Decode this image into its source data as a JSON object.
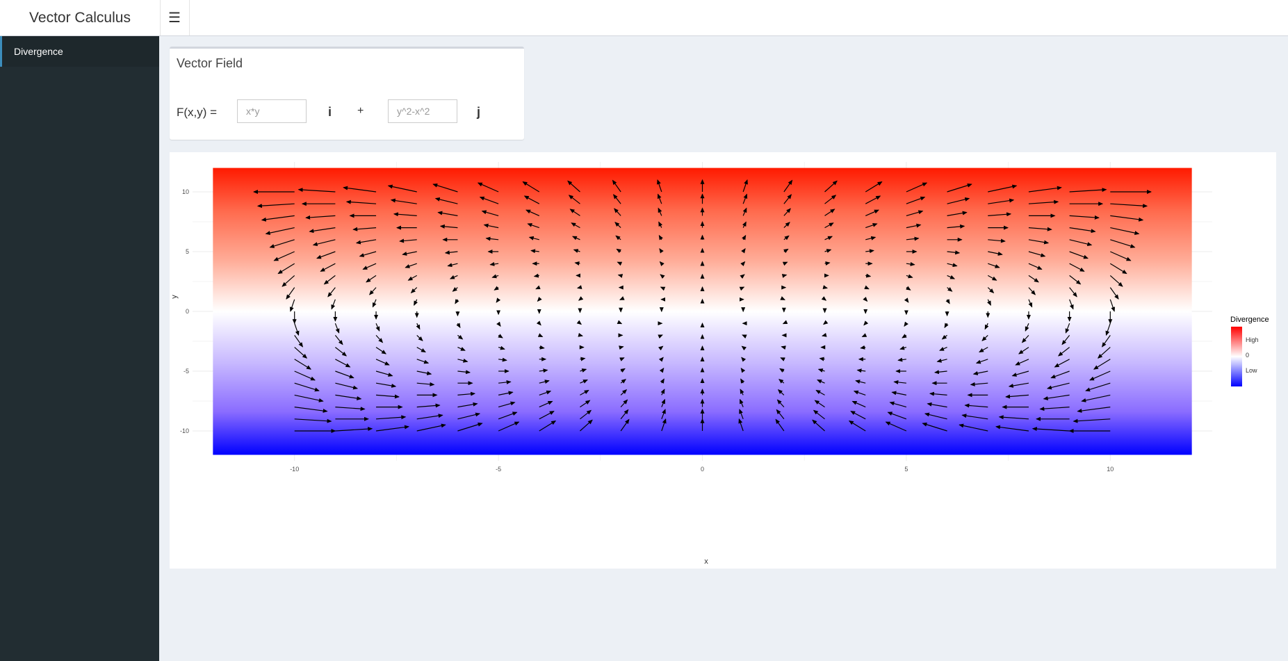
{
  "app": {
    "title": "Vector Calculus"
  },
  "header": {
    "toggle_icon": "hamburger-menu-icon"
  },
  "sidebar": {
    "items": [
      {
        "label": "Divergence",
        "active": true
      }
    ]
  },
  "vector_field": {
    "title": "Vector Field",
    "f_label": "F(x,y) =",
    "i_field": {
      "value": "",
      "placeholder": "x*y"
    },
    "i_unit": "i",
    "plus": "+",
    "j_field": {
      "value": "",
      "placeholder": "y^2-x^2"
    },
    "j_unit": "j"
  },
  "colors": {
    "high": "#ff0000",
    "zero": "#ffffff",
    "low": "#0000ff",
    "arrow": "#000000",
    "accent": "#3c8dbc"
  },
  "chart_data": {
    "type": "vector-field",
    "field": {
      "Fx": "x*y",
      "Fy": "y^2-x^2"
    },
    "grid": {
      "x_from": -10,
      "x_to": 10,
      "x_step": 1,
      "y_from": -10,
      "y_to": 10,
      "y_step": 1
    },
    "xlim": [
      -12.5,
      12.5
    ],
    "ylim": [
      -12.5,
      12.5
    ],
    "divergence_fill": {
      "x_range": [
        -12,
        12
      ],
      "y_range": [
        -12,
        12
      ],
      "divergence": "3*y"
    },
    "x_ticks": [
      -10,
      -5,
      0,
      5,
      10
    ],
    "x_tick_labels": [
      "-10",
      "-5",
      "0",
      "5",
      "10"
    ],
    "y_ticks": [
      -10,
      -5,
      0,
      5,
      10
    ],
    "y_tick_labels": [
      "-10",
      "-5",
      "0",
      "5",
      "10"
    ],
    "xlabel": "x",
    "ylabel": "y",
    "legend": {
      "title": "Divergence",
      "labels": [
        "High",
        "0",
        "Low"
      ],
      "placement": "right"
    }
  }
}
